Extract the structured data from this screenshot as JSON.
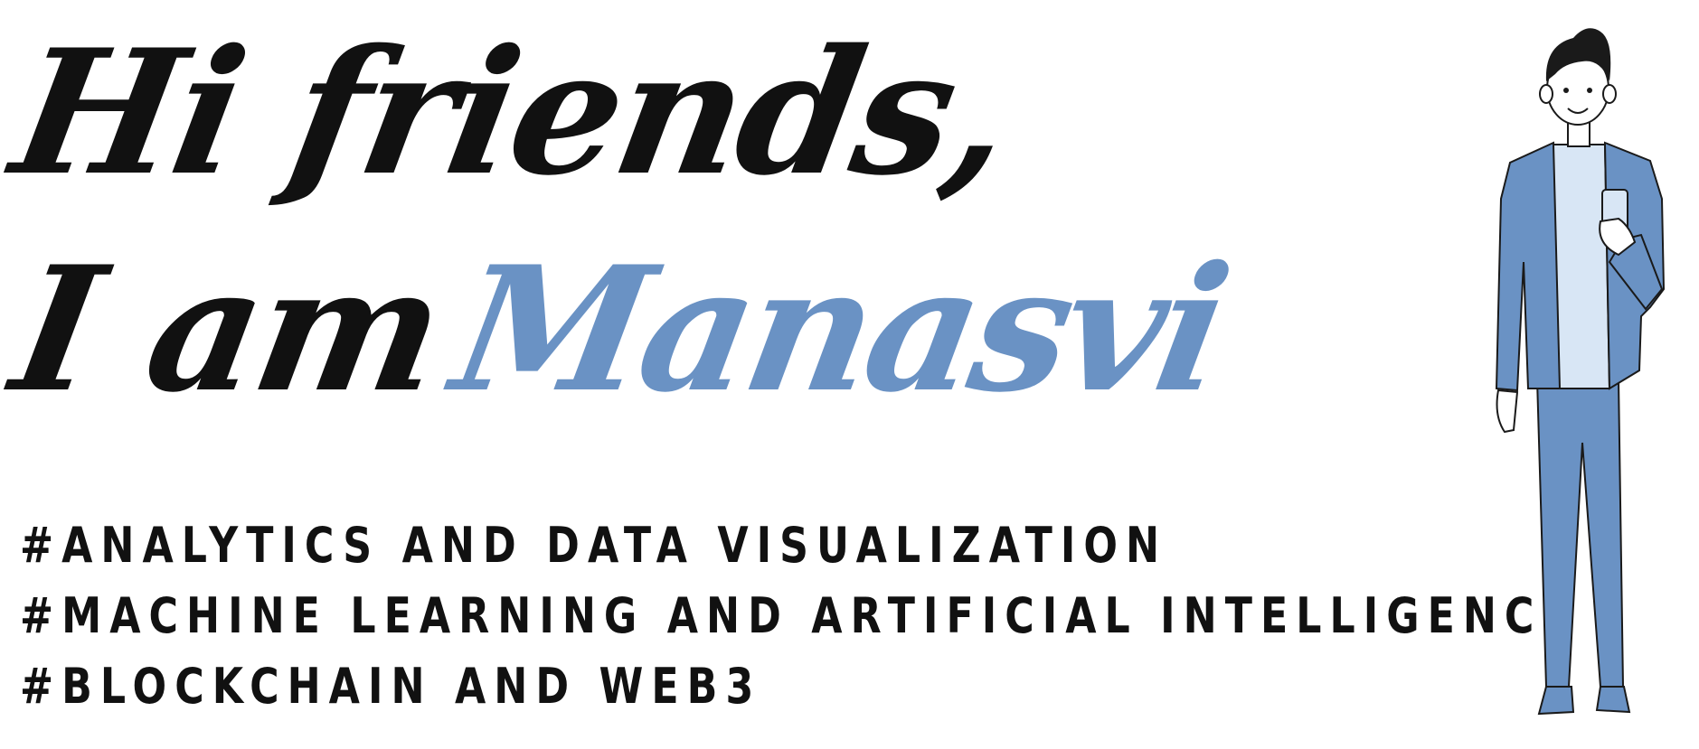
{
  "greeting": {
    "line1": "Hi friends,",
    "line2_prefix": "I am",
    "name": "Manasvi"
  },
  "tags": [
    "#ANALYTICS AND DATA VISUALIZATION",
    "#MACHINE LEARNING AND ARTIFICIAL INTELLIGENCE",
    "#BLOCKCHAIN AND WEB3"
  ],
  "colors": {
    "text": "#111111",
    "accent": "#6a92c4",
    "accent_light": "#d8e6f5"
  },
  "illustration": {
    "icon": "person-with-phone-illustration"
  }
}
